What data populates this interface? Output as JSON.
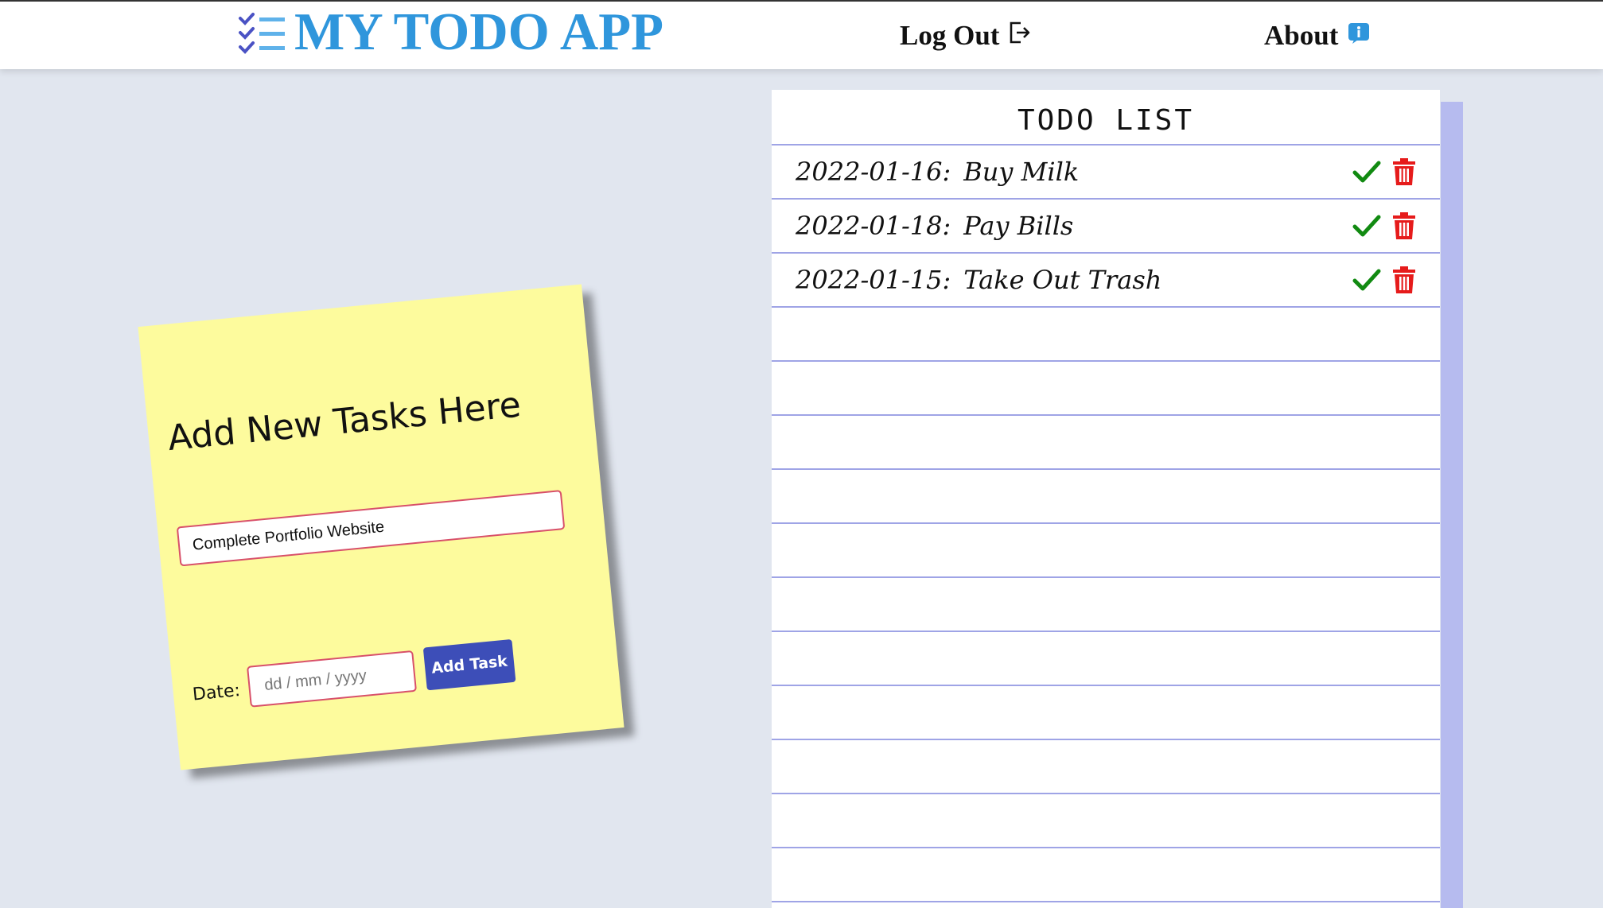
{
  "header": {
    "app_title": "MY TODO APP",
    "nav": {
      "logout_label": "Log Out",
      "about_label": "About"
    },
    "icons": {
      "logo": "checklist-icon",
      "logout": "logout-icon",
      "about": "info-icon"
    }
  },
  "add_form": {
    "title": "Add New Tasks Here",
    "task_value": "Complete Portfolio Website",
    "date_label": "Date:",
    "date_placeholder": "dd / mm / yyyy",
    "add_button_label": "Add Task"
  },
  "todo_list": {
    "title": "TODO LIST",
    "items": [
      {
        "date": "2022-01-16:",
        "text": "Buy Milk"
      },
      {
        "date": "2022-01-18:",
        "text": "Pay Bills"
      },
      {
        "date": "2022-01-15:",
        "text": "Take Out Trash"
      }
    ],
    "item_icons": {
      "complete": "checkmark-icon",
      "delete": "trash-icon"
    }
  },
  "colors": {
    "brand_blue": "#2f96dc",
    "background": "#e1e6ef",
    "sticky_yellow": "#fdfb9d",
    "button_blue": "#3d4eb8",
    "input_border": "#d8506a",
    "check_green": "#118a11",
    "trash_red": "#e61b1b",
    "paper_line": "#9fa4e6"
  }
}
